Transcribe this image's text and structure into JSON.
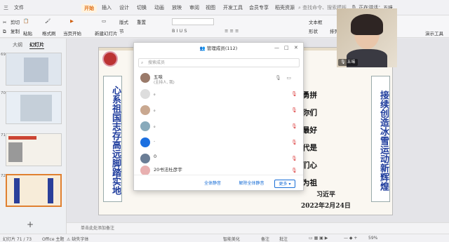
{
  "menu": {
    "items": [
      "三",
      "文件",
      "开始",
      "插入",
      "设计",
      "切换",
      "动画",
      "放映",
      "审阅",
      "视图",
      "开发工具",
      "会员专享",
      "稻壳资源"
    ],
    "active": "开始",
    "search_placeholder": "查找命令、搜索模板",
    "speaking": "正在讲话：五味"
  },
  "ribbon": {
    "cut": "剪切",
    "copy": "复制",
    "paste": "粘贴",
    "format_painter": "格式刷",
    "play_from_current": "当页开始",
    "new_slide": "新建幻灯片",
    "layout": "版式",
    "section": "节",
    "reset": "重置",
    "text_box": "文本框",
    "shape": "形状",
    "arrange": "排列",
    "presenter_tools": "演示工具"
  },
  "left_panel": {
    "tab_outline": "大纲",
    "tab_slides": "幻灯片",
    "thumb_numbers": [
      "69",
      "70",
      "71",
      "72"
    ],
    "add_icon": "+"
  },
  "slide": {
    "left_vertical": "心系祖国志存高远脚踏实地",
    "right_vertical": "接续创造冰雪运动新辉煌",
    "body_lines": [
      "奥赛场奋勇拼",
      "祝贺！为你们",
      "长在一个最好",
      "运。新时代是",
      "。希望你们心",
      "彩人生，为祖"
    ],
    "author": "习近平",
    "date": "2022年2月24日"
  },
  "dialog": {
    "title": "管理成员(112)",
    "search_placeholder": "搜索成员",
    "members": [
      {
        "name": "五味",
        "sub": "(主持人, 我)"
      },
      {
        "name": "。",
        "sub": ""
      },
      {
        "name": "。",
        "sub": ""
      },
      {
        "name": "。",
        "sub": ""
      },
      {
        "name": ".",
        "sub": ""
      },
      {
        "name": "0",
        "sub": ""
      },
      {
        "name": "20书法杜彦宇",
        "sub": ""
      }
    ],
    "mute_all": "全体静音",
    "unmute_all": "解除全体静音",
    "more": "更多"
  },
  "video": {
    "name": "五味"
  },
  "notes": {
    "placeholder": "单击此处添加备注"
  },
  "statusbar": {
    "page": "幻灯片 71 / 73",
    "theme": "Office 主题",
    "font_missing": "缺失字体",
    "smart_beautify": "智能美化",
    "notes": "备注",
    "comments": "批注",
    "zoom": "59%"
  }
}
